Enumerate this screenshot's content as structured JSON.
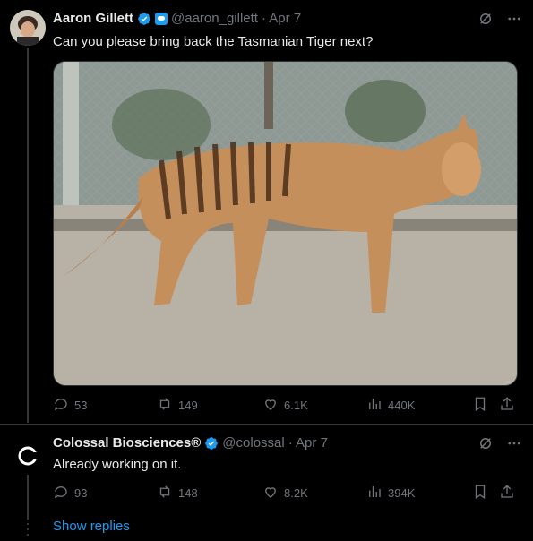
{
  "colors": {
    "background": "#000000",
    "text": "#e7e9ea",
    "muted": "#71767b",
    "accent": "#1d9bf0"
  },
  "tweet": {
    "author_name": "Aaron Gillett",
    "handle": "@aaron_gillett",
    "date": "· Apr 7",
    "text": "Can you please bring back the Tasmanian Tiger next?",
    "media_description_icon": "photo",
    "stats": {
      "replies": "53",
      "reposts": "149",
      "likes": "6.1K",
      "views": "440K"
    }
  },
  "reply": {
    "author_name": "Colossal Biosciences®",
    "handle": "@colossal",
    "date": "· Apr 7",
    "text": "Already working on it.",
    "stats": {
      "replies": "93",
      "reposts": "148",
      "likes": "8.2K",
      "views": "394K"
    }
  },
  "show_replies": "Show replies",
  "icons": [
    "verified-icon",
    "grok-icon",
    "more-icon",
    "reply-icon",
    "repost-icon",
    "like-icon",
    "views-icon",
    "bookmark-icon",
    "share-icon"
  ]
}
